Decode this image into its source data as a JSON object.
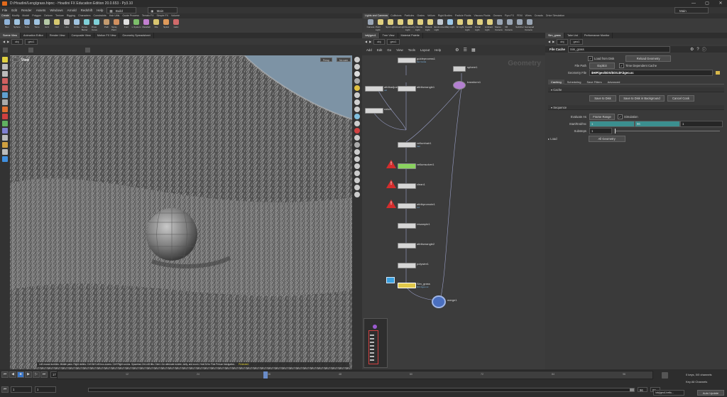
{
  "window": {
    "title": "D:/Houdini/Leng/grass.hipnc - Houdini FX Education Edition 20.0.653 - Py3.10",
    "minimize": "—",
    "maximize": "▢",
    "close": "✕"
  },
  "menu": {
    "items": [
      "File",
      "Edit",
      "Render",
      "Assets",
      "Windows",
      "Arnold",
      "Redshift",
      "Help"
    ],
    "build_label": "Build",
    "desktop_label": "Main",
    "main_label": "Main"
  },
  "shelf_left": {
    "tabs": [
      "Create",
      "Modify",
      "Model",
      "Polygon",
      "Deform",
      "Texture",
      "Rigging",
      "Characters",
      "Constraints",
      "Hair Utils",
      "Guide Process",
      "Terrain FX",
      "Simple FX",
      "Volume"
    ],
    "tools": [
      {
        "label": "Box",
        "color": "#8fb3d9"
      },
      {
        "label": "Sphere",
        "color": "#9fc3e0"
      },
      {
        "label": "Tube",
        "color": "#8fb3d9"
      },
      {
        "label": "Torus",
        "color": "#9fc3e0"
      },
      {
        "label": "Grid",
        "color": "#b5c9a6"
      },
      {
        "label": "Null",
        "color": "#d6c86f"
      },
      {
        "label": "Line",
        "color": "#c4c4c4"
      },
      {
        "label": "Circle",
        "color": "#9fc3e0"
      },
      {
        "label": "Curve Bezier",
        "color": "#7fd0d8"
      },
      {
        "label": "Draw Curve",
        "color": "#7fd0d8"
      },
      {
        "label": "Path",
        "color": "#c49b6f"
      },
      {
        "label": "Spray Paint",
        "color": "#d08f5f"
      },
      {
        "label": "Font",
        "color": "#e0e0e0"
      },
      {
        "label": "L-System",
        "color": "#7cbf6a"
      },
      {
        "label": "Metaball",
        "color": "#c37fd0"
      },
      {
        "label": "File",
        "color": "#d8c56f"
      },
      {
        "label": "Spiral",
        "color": "#e09a5a"
      },
      {
        "label": "Helix",
        "color": "#d06a6a"
      }
    ]
  },
  "shelf_right": {
    "tabs": [
      "Lights and Cameras",
      "Collisions",
      "Particles",
      "Grains",
      "Vellum",
      "Rigid Bodies",
      "Particle Fluids",
      "Viscous Fluids",
      "Oceans",
      "Pyro FX",
      "FEM",
      "Wires",
      "Crowds",
      "Drive Simulation"
    ],
    "tools": [
      {
        "label": "Camera",
        "color": "#9aa6b5"
      },
      {
        "label": "Point Light",
        "color": "#e0d080"
      },
      {
        "label": "Spot Light",
        "color": "#e0d080"
      },
      {
        "label": "Area Light",
        "color": "#e0d080"
      },
      {
        "label": "Geometry Light",
        "color": "#e0d080"
      },
      {
        "label": "Volume Light",
        "color": "#e0d080"
      },
      {
        "label": "Distant Light",
        "color": "#e0d080"
      },
      {
        "label": "Environment Light",
        "color": "#c0c8d0"
      },
      {
        "label": "Sky Light",
        "color": "#9cc8e8"
      },
      {
        "label": "GI Light",
        "color": "#e0d080"
      },
      {
        "label": "Caustic Light",
        "color": "#e0d080"
      },
      {
        "label": "Portal Light",
        "color": "#e0d080"
      },
      {
        "label": "Ambient Light",
        "color": "#e0d080"
      },
      {
        "label": "Stereo Camera",
        "color": "#9aa6b5"
      },
      {
        "label": "VR Camera",
        "color": "#9aa6b5"
      },
      {
        "label": "Switcher",
        "color": "#9aa6b5"
      },
      {
        "label": "Gamepad Camera",
        "color": "#9aa6b5"
      }
    ]
  },
  "left_tabs": [
    "Scene View",
    "Animation Editor",
    "Render View",
    "Composite View",
    "Motion FX View",
    "Geometry Spreadsheet"
  ],
  "mid_tabs": [
    "/obj/geo1",
    "Tree View",
    "Material Palette"
  ],
  "right_tabs": [
    "Sim_grass",
    "Take List",
    "Performance Monitor"
  ],
  "path": {
    "obj": "obj",
    "geo": "geo1"
  },
  "viewport": {
    "label": "View",
    "persp": "Persp",
    "cam": "No cam",
    "status": "Left mouse tumbles. Middle pans. Right dollies. Ctrl+Alt+Left box-zooms. Ctrl+Right zooms. Spacebar-Ctrl-Left tilts. Hold L for alternate tumble, dolly, and zoom. Hold M for First Person Navigation.",
    "status_tag": "Persistent"
  },
  "network": {
    "menu": [
      "Add",
      "Edit",
      "Go",
      "View",
      "Tools",
      "Layout",
      "Help"
    ],
    "watermark": "Geometry",
    "nodes": [
      {
        "name": "guideprocess1",
        "sub": "Set Guide"
      },
      {
        "name": "sphere1",
        "sub": ""
      },
      {
        "name": "transform1",
        "sub": ""
      },
      {
        "name": "attribadjustfloat1",
        "sub": "val"
      },
      {
        "name": "attribwrangle1",
        "sub": ""
      },
      {
        "name": "color1",
        "sub": ""
      },
      {
        "name": "vellumhair1",
        "sub": "hair"
      },
      {
        "name": "vellumsolver1",
        "sub": ""
      },
      {
        "name": "clean1",
        "sub": ""
      },
      {
        "name": "attribpromote1",
        "sub": "Cd"
      },
      {
        "name": "resample1",
        "sub": ""
      },
      {
        "name": "attribwrangle2",
        "sub": ""
      },
      {
        "name": "polywire1",
        "sub": ""
      },
      {
        "name": "Sim_grass",
        "sub": "$F4.bgeo.sc"
      },
      {
        "name": "merge1",
        "sub": ""
      }
    ],
    "warn_mark": "!"
  },
  "params": {
    "node_type": "File Cache",
    "node_name": "Sim_grass",
    "load_from_disk": "Load from Disk",
    "reload": "Reload Geometry",
    "file_path_label": "File Path",
    "file_path_mode": "Explicit",
    "time_dep": "Time Dependent Cache",
    "geo_file_label": "Geometry File",
    "geo_file": "$HIP/geo/$OS/$OS.$F.bgeo.sc",
    "tabs": [
      "Caching",
      "Scheduling",
      "Save Filters",
      "Advanced"
    ],
    "cache_section": "Cache",
    "save_disk": "Save to Disk",
    "save_bg": "Save to Disk in Background",
    "cancel": "Cancel Cook",
    "sequence_section": "Sequence",
    "evaluate_label": "Evaluate As",
    "evaluate_value": "Frame Range",
    "simulation": "Simulation",
    "start_label": "Start/End/Inc",
    "start": "1",
    "end": "96",
    "inc": "1",
    "substeps_label": "Substeps",
    "substeps": "1",
    "load_section": "Load",
    "load_value": "All Geometry"
  },
  "timeline": {
    "frame": "17",
    "start": "1",
    "start2": "1",
    "end": "96",
    "end2": "96",
    "ticks": [
      "12",
      "24",
      "36",
      "48",
      "60",
      "72",
      "84",
      "96"
    ],
    "keys_label": "0 keys, 0/0 channels",
    "key_all": "Key All Channels",
    "auto_update": "Auto Update",
    "path_chip": "/obj/geo1/vellu..."
  },
  "colors": {
    "accent_green": "#8ad25f",
    "accent_blue": "#3aa0e0",
    "warn_red": "#d42d2d",
    "teal": "#3b8f8f"
  }
}
